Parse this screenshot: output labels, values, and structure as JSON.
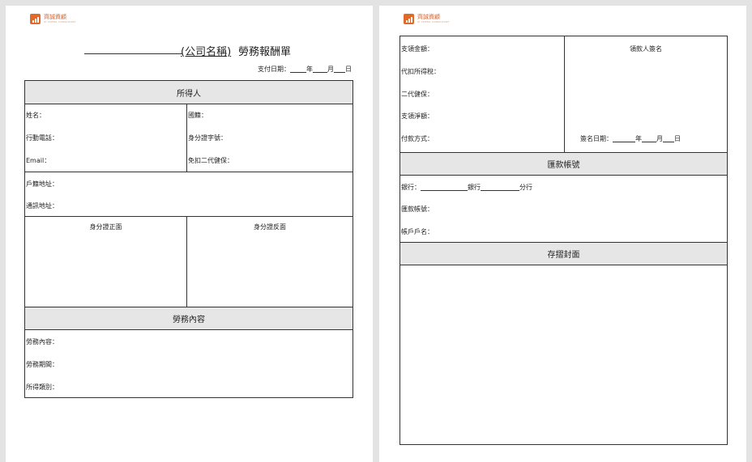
{
  "logo": {
    "name": "齊誠資顧",
    "sub": "QI CHENG CONSULTANT"
  },
  "left": {
    "company": "(公司名稱)",
    "title": "勞務報酬單",
    "pay_date": {
      "label": "支付日期：",
      "year": "年",
      "month": "月",
      "day": "日"
    },
    "section_income": "所得人",
    "name": "姓名：",
    "nationality": "國籍：",
    "phone": "行動電話：",
    "id_no": "身分證字號：",
    "email": "Email：",
    "nhi_exempt": "免扣二代健保：",
    "household_address": "戶籍地址：",
    "mail_address": "通訊地址：",
    "id_front": "身分證正面",
    "id_back": "身分證反面",
    "section_labor": "勞務內容",
    "labor_content": "勞務內容：",
    "labor_period": "勞務期間：",
    "income_type": "所得類別："
  },
  "right": {
    "pay_amount": "支領金額：",
    "withholding_tax": "代扣所得稅：",
    "nhi_2nd": "二代健保：",
    "net_amount": "支領淨額：",
    "payment_method": "付款方式：",
    "payee_signature": "領款人簽名",
    "sign_date": {
      "label": "簽名日期：",
      "year": "年",
      "month": "月",
      "day": "日"
    },
    "section_remit": "匯款帳號",
    "bank_label": "銀行：",
    "bank_suffix": "銀行",
    "branch_suffix": "分行",
    "account_no": "匯款帳號：",
    "account_name": "帳戶戶名：",
    "section_cover": "存摺封面"
  }
}
